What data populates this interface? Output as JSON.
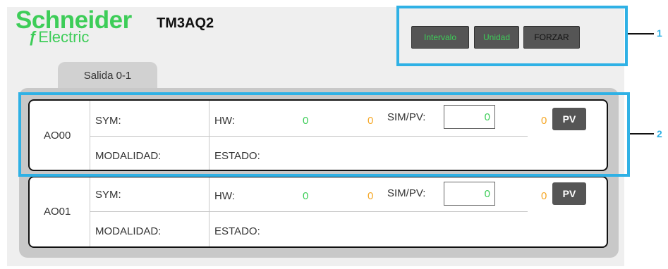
{
  "header": {
    "logo_top": "Schneider",
    "logo_bottom": "Electric",
    "model": "TM3AQ2"
  },
  "toolbar": {
    "intervalo_label": "Intervalo",
    "unidad_label": "Unidad",
    "forzar_label": "FORZAR"
  },
  "callouts": [
    "1",
    "2"
  ],
  "tabs": [
    {
      "label": "Salida 0-1"
    }
  ],
  "channels": [
    {
      "id": "AO00",
      "sym_label": "SYM:",
      "hw_label": "HW:",
      "hw_value": "0",
      "hw_secondary": "0",
      "sim_label": "SIM/PV:",
      "sim_value": "0",
      "pv_value": "0",
      "pv_button": "PV",
      "mode_label": "MODALIDAD:",
      "state_label": "ESTADO:"
    },
    {
      "id": "AO01",
      "sym_label": "SYM:",
      "hw_label": "HW:",
      "hw_value": "0",
      "hw_secondary": "0",
      "sim_label": "SIM/PV:",
      "sim_value": "0",
      "pv_value": "0",
      "pv_button": "PV",
      "mode_label": "MODALIDAD:",
      "state_label": "ESTADO:"
    }
  ],
  "colors": {
    "brand_green": "#3dcd58",
    "callout_blue": "#2fb1e5",
    "value_orange": "#f5a623"
  }
}
